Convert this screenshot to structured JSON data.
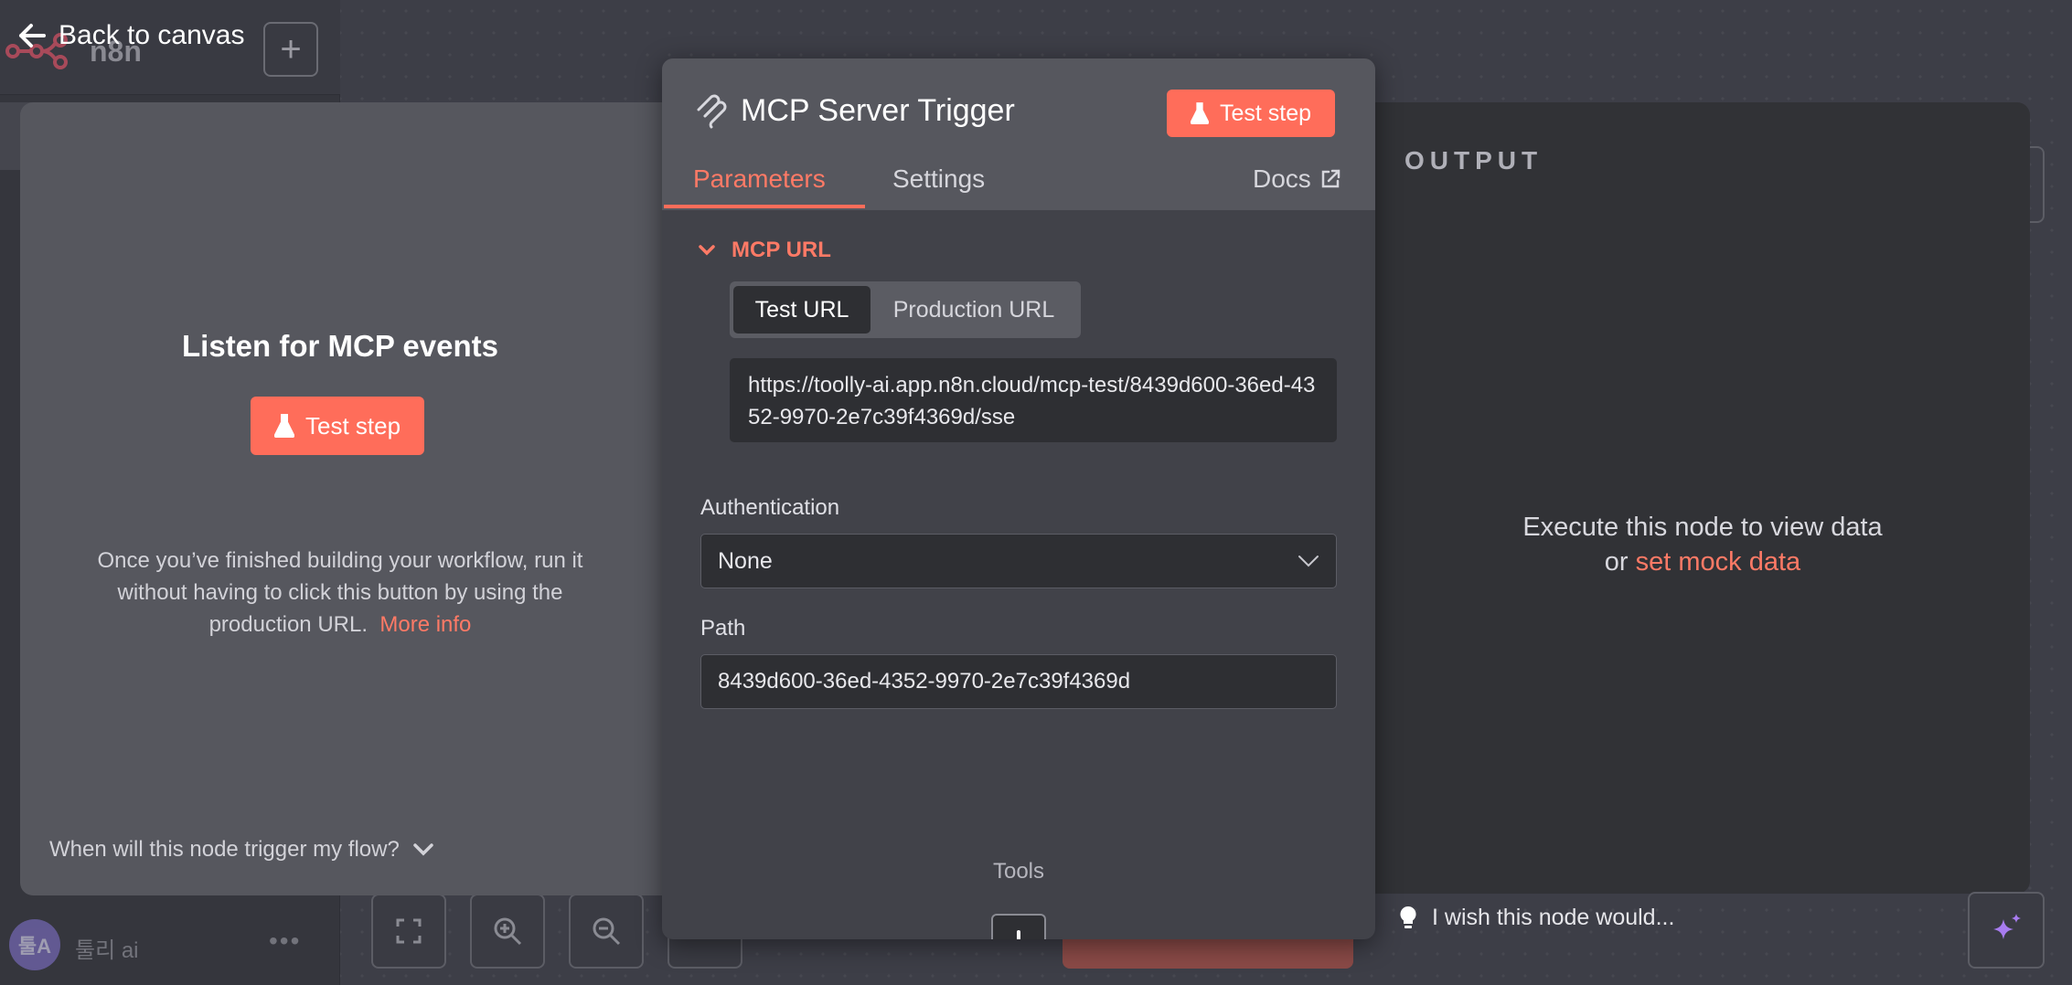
{
  "app": {
    "logo_text": "n8n",
    "user_initials": "툴A",
    "user_name": "툴리 ai",
    "user_menu_glyph": "•••"
  },
  "nav": {
    "back_label": "Back to canvas"
  },
  "input_panel": {
    "title": "Listen for MCP events",
    "test_step_label": "Test step",
    "description": "Once you’ve finished building your workflow, run it without having to click this button by using the production URL.",
    "more_info_label": "More info",
    "trigger_question": "When will this node trigger my flow?"
  },
  "node": {
    "title": "MCP Server Trigger",
    "test_step_label": "Test step",
    "tabs": {
      "parameters": "Parameters",
      "settings": "Settings",
      "docs": "Docs"
    },
    "mcp_url": {
      "section_label": "MCP URL",
      "options": [
        "Test URL",
        "Production URL"
      ],
      "selected": "Test URL",
      "url": "https://toolly-ai.app.n8n.cloud/mcp-test/8439d600-36ed-4352-9970-2e7c39f4369d/sse"
    },
    "authentication": {
      "label": "Authentication",
      "value": "None"
    },
    "path": {
      "label": "Path",
      "value": "8439d600-36ed-4352-9970-2e7c39f4369d"
    },
    "tools_label": "Tools"
  },
  "output_panel": {
    "title": "OUTPUT",
    "message_line1": "Execute this node to view data",
    "message_or": "or",
    "mock_data_link": "set mock data"
  },
  "feedback": {
    "wish_label": "I wish this node would..."
  },
  "colors": {
    "accent": "#ff6d5a",
    "accent_text": "#ff7a66",
    "panel_bg": "#414249",
    "input_bg": "#2e2f33",
    "ai_icon": "#a87cf0"
  }
}
